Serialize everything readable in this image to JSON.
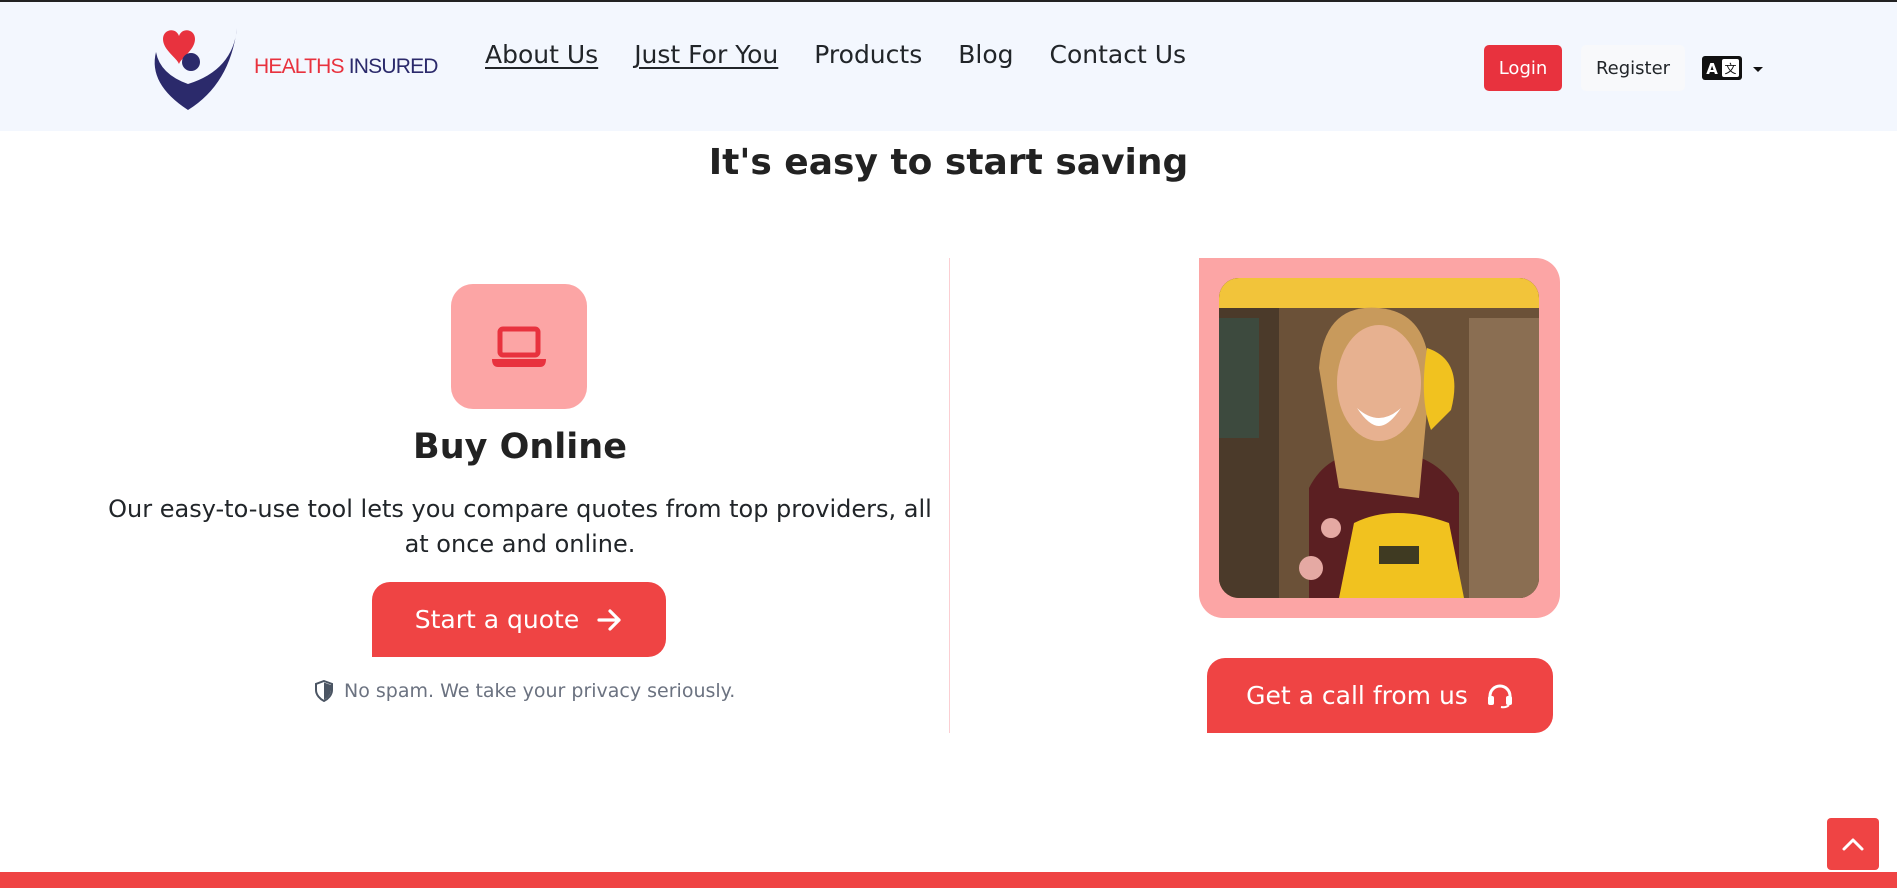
{
  "brand": {
    "name_part1": "HEALTHS",
    "name_part2": " INSURED",
    "colors": {
      "red": "#e8323e",
      "navy": "#2b2a6b"
    }
  },
  "nav": {
    "items": [
      {
        "label": "About Us"
      },
      {
        "label": "Just For You"
      },
      {
        "label": "Products"
      },
      {
        "label": "Blog"
      },
      {
        "label": "Contact Us"
      }
    ]
  },
  "auth": {
    "login_label": "Login",
    "register_label": "Register"
  },
  "language": {
    "icon": "translate-icon"
  },
  "section": {
    "title": "It's easy to start saving"
  },
  "buy_online": {
    "icon": "laptop-icon",
    "title": "Buy Online",
    "description": "Our easy-to-use tool lets you compare quotes from top providers, all at once and online.",
    "cta_label": "Start a quote",
    "privacy_note": "No spam. We take your privacy seriously."
  },
  "call": {
    "cta_label": "Get a call from us",
    "icon": "headset-icon"
  },
  "theme": {
    "accent": "#ef4444",
    "accent_light": "#fca5a5",
    "header_bg": "#f3f7fe"
  }
}
